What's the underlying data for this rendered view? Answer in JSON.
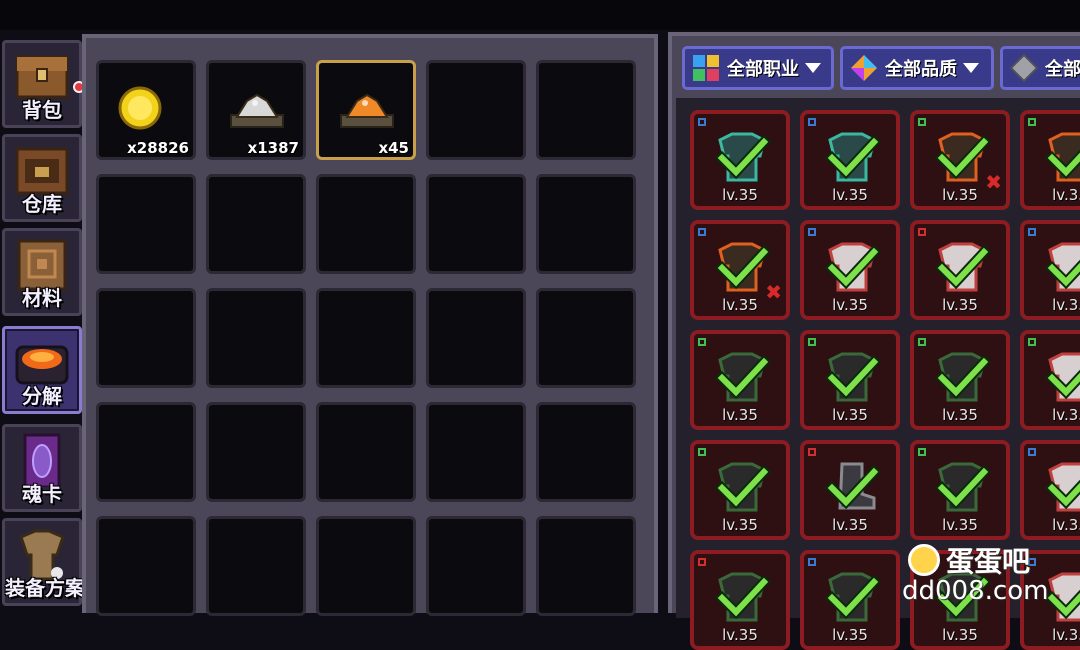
{
  "sidebar": {
    "tabs": [
      {
        "label": "背包",
        "icon": "chest-icon",
        "active": false,
        "has_notification": true
      },
      {
        "label": "仓库",
        "icon": "warehouse-chest-icon",
        "active": false
      },
      {
        "label": "材料",
        "icon": "materials-book-icon",
        "active": false
      },
      {
        "label": "分解",
        "icon": "furnace-icon",
        "active": true
      },
      {
        "label": "魂卡",
        "icon": "soul-card-icon",
        "active": false
      },
      {
        "label": "装备方案",
        "icon": "armor-set-icon",
        "active": false
      }
    ]
  },
  "inventory": {
    "items": [
      {
        "name": "gold-coin-icon",
        "qty": "x28826",
        "color": "#f2d21a"
      },
      {
        "name": "silver-ore-icon",
        "qty": "x1387",
        "color": "#d8d8d8"
      },
      {
        "name": "orange-ore-icon",
        "qty": "x45",
        "color": "#f08a28",
        "selected": true
      }
    ]
  },
  "equipment": {
    "filters": [
      {
        "label": "全部职业",
        "icon": "class-grid-icon"
      },
      {
        "label": "全部品质",
        "icon": "quality-gem-icon"
      },
      {
        "label": "全部",
        "icon": "gray-gem-icon"
      }
    ],
    "level_label": "lv.35",
    "slots": [
      {
        "art": "teal-armor",
        "marks": [
          "blue"
        ]
      },
      {
        "art": "teal-armor",
        "marks": [
          "blue"
        ]
      },
      {
        "art": "flame-armor",
        "marks": [
          "green"
        ],
        "x": true
      },
      {
        "art": "flame-armor",
        "marks": [
          "green"
        ]
      },
      {
        "art": "flame-armor",
        "marks": [
          "blue"
        ],
        "x": true
      },
      {
        "art": "white-armor",
        "marks": [
          "blue"
        ]
      },
      {
        "art": "white-armor",
        "marks": [
          "red"
        ]
      },
      {
        "art": "white-armor",
        "marks": [
          "blue"
        ]
      },
      {
        "art": "dark-armor",
        "marks": [
          "green"
        ]
      },
      {
        "art": "dark-armor",
        "marks": [
          "green"
        ]
      },
      {
        "art": "dark-armor",
        "marks": [
          "green"
        ]
      },
      {
        "art": "white-armor",
        "marks": [
          "green"
        ]
      },
      {
        "art": "dark-armor",
        "marks": [
          "green"
        ]
      },
      {
        "art": "dark-boot",
        "marks": [
          "red"
        ]
      },
      {
        "art": "dark-armor",
        "marks": [
          "green"
        ]
      },
      {
        "art": "white-armor",
        "marks": [
          "blue"
        ]
      },
      {
        "art": "dark-armor",
        "marks": [
          "red"
        ]
      },
      {
        "art": "dark-armor",
        "marks": [
          "blue"
        ]
      },
      {
        "art": "dark-armor",
        "marks": [
          "green"
        ]
      },
      {
        "art": "white-armor",
        "marks": [
          "blue"
        ]
      }
    ]
  },
  "watermark": {
    "brand": "蛋蛋吧",
    "url": "dd008.com"
  }
}
